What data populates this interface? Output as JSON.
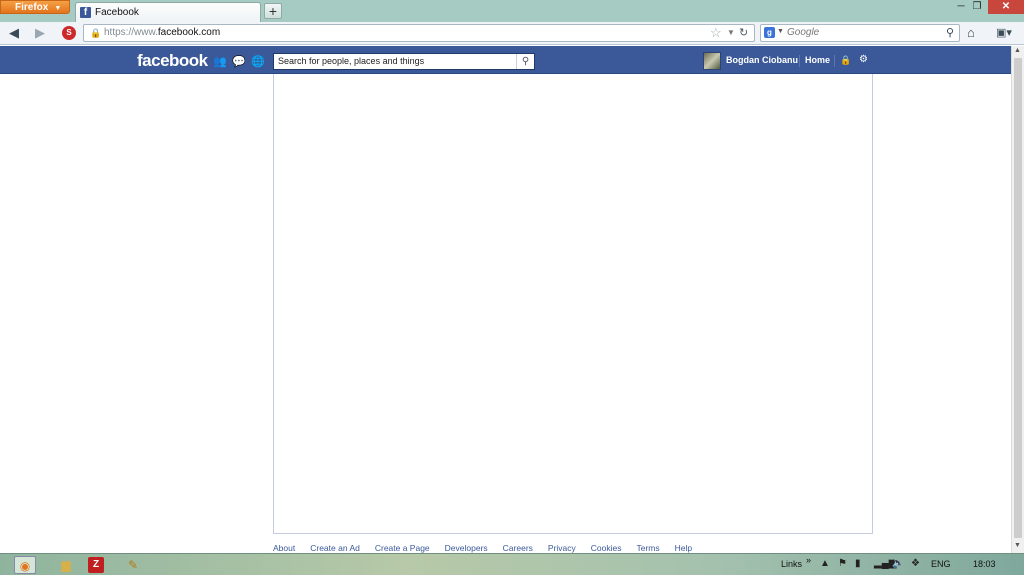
{
  "browser": {
    "menu_label": "Firefox",
    "tab_title": "Facebook",
    "newtab_label": "+",
    "url_prefix": "https://www.",
    "url_host": "facebook.com",
    "search_engine_label": "g",
    "search_placeholder": "Google"
  },
  "facebook": {
    "logo": "facebook",
    "search_placeholder": "Search for people, places and things",
    "user_name": "Bogdan Ciobanu",
    "home_label": "Home",
    "brand_color": "#3b5998"
  },
  "footer": {
    "links": [
      "About",
      "Create an Ad",
      "Create a Page",
      "Developers",
      "Careers",
      "Privacy",
      "Cookies",
      "Terms",
      "Help"
    ]
  },
  "taskbar": {
    "links_label": "Links",
    "language": "ENG",
    "time": "18:03"
  }
}
